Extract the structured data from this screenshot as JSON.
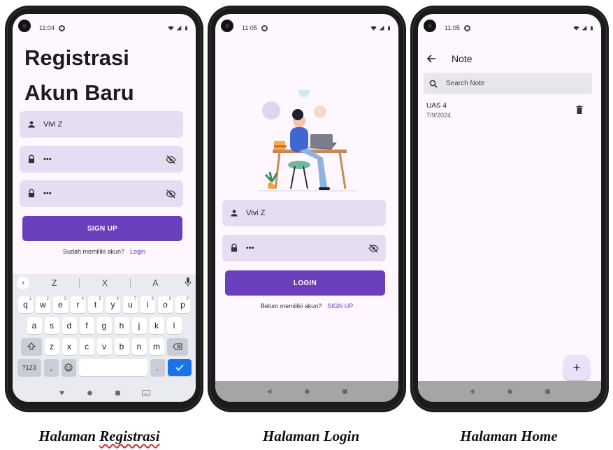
{
  "reg": {
    "time": "11:04",
    "title_line1": "Registrasi",
    "title_line2": "Akun Baru",
    "username_value": "Vivi Z",
    "password_value": "•••",
    "confirm_value": "•••",
    "signup_label": "SIGN UP",
    "prompt_text": "Sudah memiliki akun?",
    "prompt_link": "Login",
    "suggestions": [
      "Z",
      "X",
      "A"
    ],
    "row1": [
      [
        "q",
        "1"
      ],
      [
        "w",
        "2"
      ],
      [
        "e",
        "3"
      ],
      [
        "r",
        "4"
      ],
      [
        "t",
        "5"
      ],
      [
        "y",
        "6"
      ],
      [
        "u",
        "7"
      ],
      [
        "i",
        "8"
      ],
      [
        "o",
        "9"
      ],
      [
        "p",
        "0"
      ]
    ],
    "row2": [
      "a",
      "s",
      "d",
      "f",
      "g",
      "h",
      "j",
      "k",
      "l"
    ],
    "row3": [
      "z",
      "x",
      "c",
      "v",
      "b",
      "n",
      "m"
    ],
    "sym_label": "?123",
    "comma": ",",
    "period": "."
  },
  "login": {
    "time": "11:05",
    "username_value": "Vivi Z",
    "password_value": "•••",
    "login_label": "LOGIN",
    "prompt_text": "Belum memiliki akun?",
    "prompt_link": "SIGN UP"
  },
  "home": {
    "time": "11:05",
    "title": "Note",
    "search_placeholder": "Search Note",
    "notes": [
      {
        "title": "UAS 4",
        "date": "7/9/2024"
      }
    ],
    "fab_label": "+"
  },
  "captions": {
    "reg_prefix": "Halaman ",
    "reg_word": "Registrasi",
    "login": "Halaman Login",
    "home": "Halaman Home"
  },
  "colors": {
    "primary": "#6a3fbb",
    "field_bg": "#e6ddf3",
    "screen_bg": "#fef7ff"
  }
}
